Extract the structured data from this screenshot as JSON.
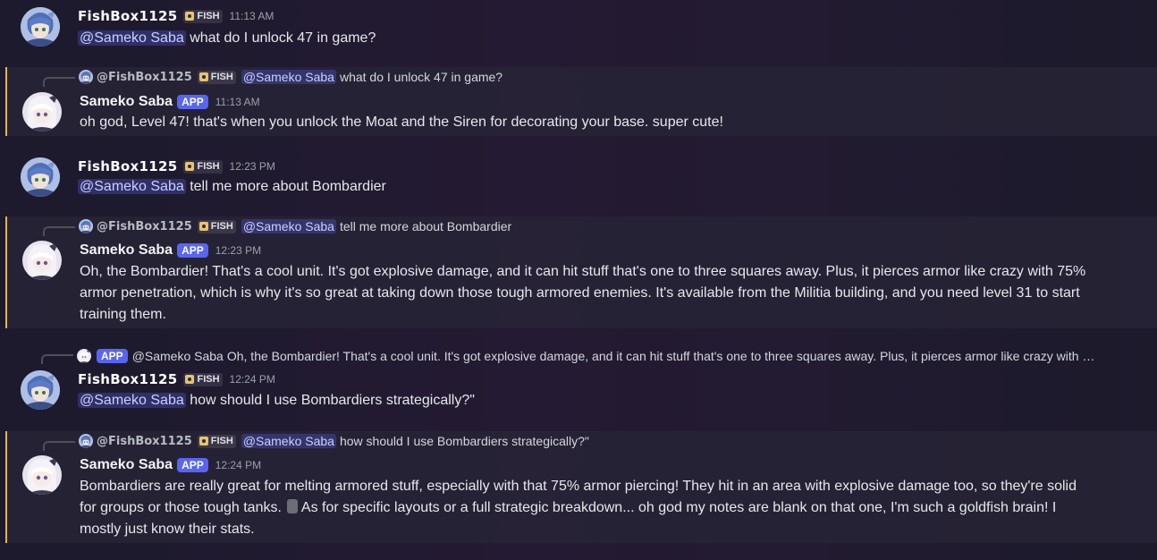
{
  "colors": {
    "highlight_border": "#e0b84c",
    "app_badge": "#5865f2",
    "mention_bg": "#5865f2",
    "fish_tag_icon": "#e9c46a"
  },
  "users": {
    "fishbox": {
      "name": "FishBox1125",
      "tag": "FISH",
      "avatar_icon": "anime-avatar-blue-hair"
    },
    "sameko": {
      "name": "Sameko Saba",
      "badge": "APP",
      "avatar_icon": "anime-avatar-white-hair"
    }
  },
  "messages": [
    {
      "author": "FishBox1125",
      "tag": "FISH",
      "time": "11:13 AM",
      "mention": "@Sameko Saba",
      "text": "what do I unlock 47 in game?"
    },
    {
      "reply": {
        "user": "@FishBox1125",
        "tag": "FISH",
        "mention": "@Sameko Saba",
        "text": "what do I unlock 47 in game?"
      },
      "author": "Sameko Saba",
      "badge": "APP",
      "time": "11:13 AM",
      "text": "oh god, Level 47! that's when you unlock the Moat and the Siren for decorating your base. super cute!"
    },
    {
      "author": "FishBox1125",
      "tag": "FISH",
      "time": "12:23 PM",
      "mention": "@Sameko Saba",
      "text": "tell me more about Bombardier"
    },
    {
      "reply": {
        "user": "@FishBox1125",
        "tag": "FISH",
        "mention": "@Sameko Saba",
        "text": "tell me more about Bombardier"
      },
      "author": "Sameko Saba",
      "badge": "APP",
      "time": "12:23 PM",
      "lines": [
        "Oh, the Bombardier! That's a cool unit. It's got explosive damage, and it can hit stuff that's one to three squares away. Plus, it pierces armor like crazy with 75%",
        "armor penetration, which is why it's so great at taking down those tough armored enemies. It's available from the Militia building, and you need level 31 to start",
        "training them."
      ]
    },
    {
      "reply": {
        "badge": "APP",
        "user": "@Sameko Saba",
        "text": "Oh, the Bombardier! That's a cool unit. It's got explosive damage, and it can hit stuff that's one to three squares away. Plus, it pierces armor like crazy with …"
      },
      "author": "FishBox1125",
      "tag": "FISH",
      "time": "12:24 PM",
      "mention": "@Sameko Saba",
      "text": "how should I use Bombardiers strategically?\""
    },
    {
      "reply": {
        "user": "@FishBox1125",
        "tag": "FISH",
        "mention": "@Sameko Saba",
        "text": "how should I use Bombardiers strategically?\""
      },
      "author": "Sameko Saba",
      "badge": "APP",
      "time": "12:24 PM",
      "lines": [
        "Bombardiers are really great for melting armored stuff, especially with that 75% armor piercing! They hit in an area with explosive damage too, so they're solid",
        "for groups or those tough tanks.",
        "As for specific layouts or a full strategic breakdown... oh god my notes are blank on that one, I'm such a goldfish brain! I",
        "mostly just know their stats."
      ],
      "emoji_icon": "grimacing-emoji-icon"
    }
  ]
}
